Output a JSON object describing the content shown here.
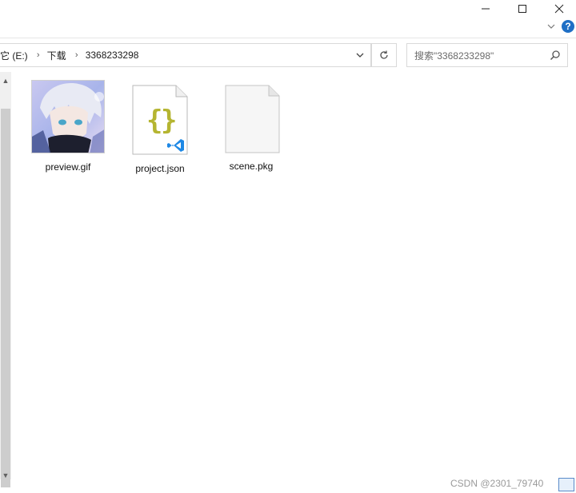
{
  "window": {
    "minimize_glyph": "—",
    "help_glyph": "?"
  },
  "address_bar": {
    "crumbs": [
      "它 (E:)",
      "下载",
      "3368233298"
    ]
  },
  "search": {
    "placeholder": "搜索\"3368233298\""
  },
  "files": [
    {
      "name": "preview.gif",
      "icon": "gif-thumbnail-icon"
    },
    {
      "name": "project.json",
      "icon": "json-vscode-file-icon"
    },
    {
      "name": "scene.pkg",
      "icon": "blank-file-icon"
    }
  ],
  "watermark": "CSDN @2301_79740",
  "colors": {
    "help_blue": "#1f6fc5",
    "json_brace": "#b5b531",
    "vscode_blue": "#1e88e5"
  }
}
